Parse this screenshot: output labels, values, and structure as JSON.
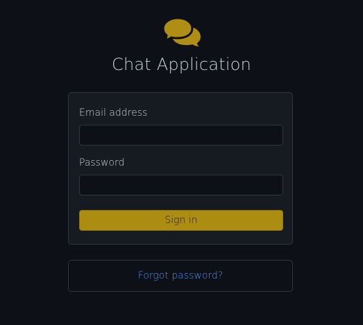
{
  "app": {
    "title": "Chat Application",
    "logo_icon": "comments-icon"
  },
  "login_form": {
    "email_label": "Email address",
    "email_value": "",
    "password_label": "Password",
    "password_value": "",
    "signin_label": "Sign in"
  },
  "forgot": {
    "link_text": "Forgot password?"
  },
  "colors": {
    "background": "#0d1117",
    "card": "#161b22",
    "accent": "#ad8c12",
    "link": "#4a8ff5"
  }
}
